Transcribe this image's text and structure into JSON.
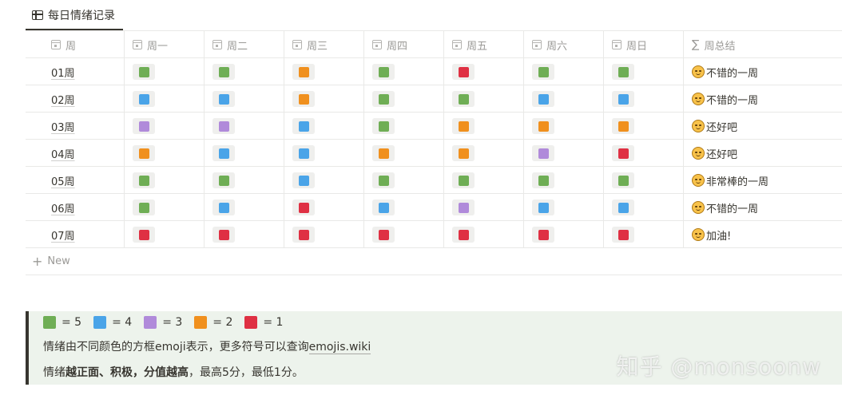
{
  "view": {
    "tab_label": "每日情绪记录"
  },
  "colors": {
    "5": "#6fae55",
    "4": "#4aa4e8",
    "3": "#b08ada",
    "2": "#f0901e",
    "1": "#df3043",
    "tag_bg": "#efefed"
  },
  "table": {
    "headers": {
      "week": "周",
      "mon": "周一",
      "tue": "周二",
      "wed": "周三",
      "thu": "周四",
      "fri": "周五",
      "sat": "周六",
      "sun": "周日",
      "summary": "周总结"
    },
    "rows": [
      {
        "week": "01周",
        "scores": [
          5,
          5,
          2,
          5,
          1,
          5,
          5
        ],
        "summary": "不错的一周"
      },
      {
        "week": "02周",
        "scores": [
          4,
          4,
          2,
          5,
          5,
          4,
          4
        ],
        "summary": "不错的一周"
      },
      {
        "week": "03周",
        "scores": [
          3,
          3,
          4,
          5,
          2,
          2,
          2
        ],
        "summary": "还好吧"
      },
      {
        "week": "04周",
        "scores": [
          2,
          4,
          4,
          2,
          2,
          3,
          1
        ],
        "summary": "还好吧"
      },
      {
        "week": "05周",
        "scores": [
          5,
          5,
          4,
          5,
          5,
          5,
          5
        ],
        "summary": "非常棒的一周"
      },
      {
        "week": "06周",
        "scores": [
          5,
          4,
          1,
          4,
          3,
          4,
          4
        ],
        "summary": "不错的一周"
      },
      {
        "week": "07周",
        "scores": [
          1,
          1,
          1,
          1,
          1,
          1,
          1
        ],
        "summary": "加油!"
      }
    ],
    "new_label": "New"
  },
  "callout": {
    "legend": [
      {
        "level": 5,
        "label": "= 5"
      },
      {
        "level": 4,
        "label": "= 4"
      },
      {
        "level": 3,
        "label": "= 3"
      },
      {
        "level": 2,
        "label": "= 2"
      },
      {
        "level": 1,
        "label": "= 1"
      }
    ],
    "line2_text": "情绪由不同颜色的方框emoji表示，更多符号可以查询",
    "line2_link": "emojis.wiki",
    "line3_pre": "情绪",
    "line3_bold": "越正面、积极，分值越高",
    "line3_post": "，最高5分，最低1分。"
  },
  "watermark": "知乎 @monsoonw"
}
